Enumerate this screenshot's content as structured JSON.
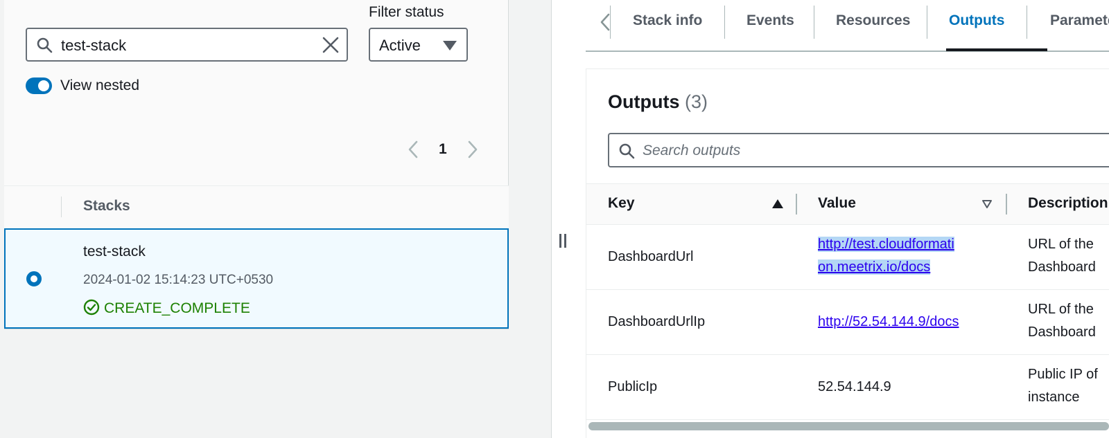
{
  "left": {
    "filter_label": "Filter status",
    "search": {
      "value": "test-stack"
    },
    "filter_select": {
      "value": "Active"
    },
    "view_nested": {
      "label": "View nested",
      "on": true
    },
    "pagination": {
      "page": "1"
    },
    "stacks_header": "Stacks",
    "stack": {
      "name": "test-stack",
      "created": "2024-01-02 15:14:23 UTC+0530",
      "status": "CREATE_COMPLETE"
    }
  },
  "tabs": [
    {
      "label": "Stack info",
      "active": false
    },
    {
      "label": "Events",
      "active": false
    },
    {
      "label": "Resources",
      "active": false
    },
    {
      "label": "Outputs",
      "active": true
    },
    {
      "label": "Parameters",
      "active": false
    }
  ],
  "outputs": {
    "title": "Outputs",
    "count": "(3)",
    "search_placeholder": "Search outputs",
    "columns": {
      "key": "Key",
      "value": "Value",
      "description": "Description"
    },
    "rows": [
      {
        "key": "DashboardUrl",
        "value_line1": "http://test.cloudformati",
        "value_line2": "on.meetrix.io/docs",
        "desc_line1": "URL of the",
        "desc_line2": "Dashboard"
      },
      {
        "key": "DashboardUrlIp",
        "value": "http://52.54.144.9/docs",
        "desc_line1": "URL of the",
        "desc_line2": "Dashboard"
      },
      {
        "key": "PublicIp",
        "value": "52.54.144.9",
        "desc_line1": "Public IP of",
        "desc_line2": "instance"
      }
    ]
  },
  "colors": {
    "accent": "#0073bb",
    "success": "#1d8102",
    "link": "#2b00ee",
    "selection": "#b4d7f5"
  }
}
